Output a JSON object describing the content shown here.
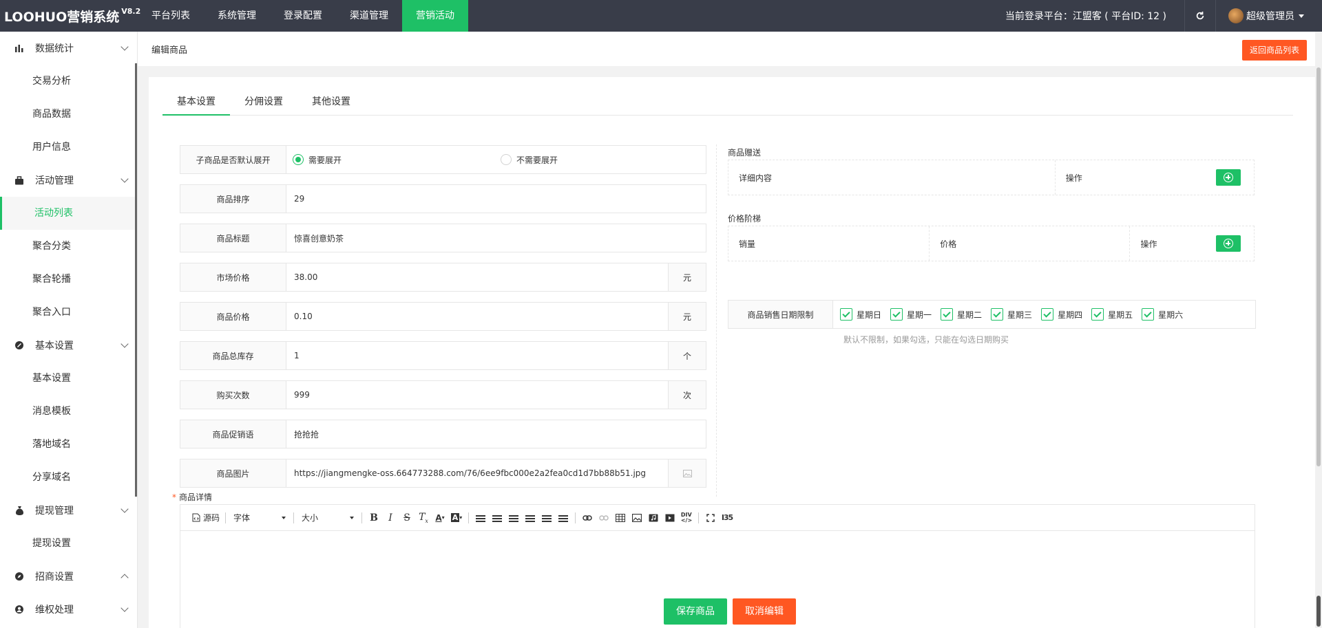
{
  "app": {
    "logo": "LOOHUO营销系统",
    "version": "V8.2"
  },
  "topnav": [
    {
      "label": "平台列表",
      "active": false
    },
    {
      "label": "系统管理",
      "active": false
    },
    {
      "label": "登录配置",
      "active": false
    },
    {
      "label": "渠道管理",
      "active": false
    },
    {
      "label": "营销活动",
      "active": true
    }
  ],
  "header": {
    "platform_info": "当前登录平台：江盟客 ( 平台ID: 12 )",
    "user": "超级管理员"
  },
  "sidebar": {
    "groups": [
      {
        "label": "数据统计",
        "icon": "bar-chart-icon",
        "items": [
          "交易分析",
          "商品数据",
          "用户信息"
        ]
      },
      {
        "label": "活动管理",
        "icon": "briefcase-icon",
        "items": [
          "活动列表",
          "聚合分类",
          "聚合轮播",
          "聚合入口"
        ]
      },
      {
        "label": "基本设置",
        "icon": "settings-icon",
        "items": [
          "基本设置",
          "消息模板",
          "落地域名",
          "分享域名"
        ]
      },
      {
        "label": "提现管理",
        "icon": "money-bag-icon",
        "items": [
          "提现设置"
        ]
      },
      {
        "label": "招商设置",
        "icon": "compass-icon",
        "items": []
      },
      {
        "label": "维权处理",
        "icon": "user-icon",
        "items": []
      }
    ],
    "active_item": "活动列表"
  },
  "page": {
    "breadcrumb": "编辑商品",
    "back_button": "返回商品列表"
  },
  "tabs": [
    {
      "label": "基本设置",
      "active": true
    },
    {
      "label": "分佣设置",
      "active": false
    },
    {
      "label": "其他设置",
      "active": false
    }
  ],
  "form": {
    "expand_label": "子商品是否默认展开",
    "expand_options": [
      {
        "label": "需要展开",
        "checked": true
      },
      {
        "label": "不需要展开",
        "checked": false
      }
    ],
    "sort_label": "商品排序",
    "sort_value": "29",
    "title_label": "商品标题",
    "title_value": "惊喜创意奶茶",
    "market_price_label": "市场价格",
    "market_price_value": "38.00",
    "market_price_unit": "元",
    "price_label": "商品价格",
    "price_value": "0.10",
    "price_unit": "元",
    "stock_label": "商品总库存",
    "stock_value": "1",
    "stock_unit": "个",
    "purchase_label": "购买次数",
    "purchase_value": "999",
    "purchase_unit": "次",
    "promo_label": "商品促销语",
    "promo_value": "抢抢抢",
    "image_label": "商品图片",
    "image_value": "https://jiangmengke-oss.664773288.com/76/6ee9fbc000e2a2fea0cd1d7bb88b51.jpg"
  },
  "right": {
    "gift_title": "商品赠送",
    "gift_cols": [
      "详细内容",
      "操作"
    ],
    "tier_title": "价格阶梯",
    "tier_cols": [
      "销量",
      "价格",
      "操作"
    ],
    "date_limit_label": "商品销售日期限制",
    "weekdays": [
      "星期日",
      "星期一",
      "星期二",
      "星期三",
      "星期四",
      "星期五",
      "星期六"
    ],
    "date_hint": "默认不限制，如果勾选，只能在勾选日期购买"
  },
  "detail": {
    "label": "商品详情",
    "toolbar": {
      "source": "源码",
      "font": "字体",
      "size": "大小"
    }
  },
  "actions": {
    "save": "保存商品",
    "cancel": "取消编辑"
  }
}
